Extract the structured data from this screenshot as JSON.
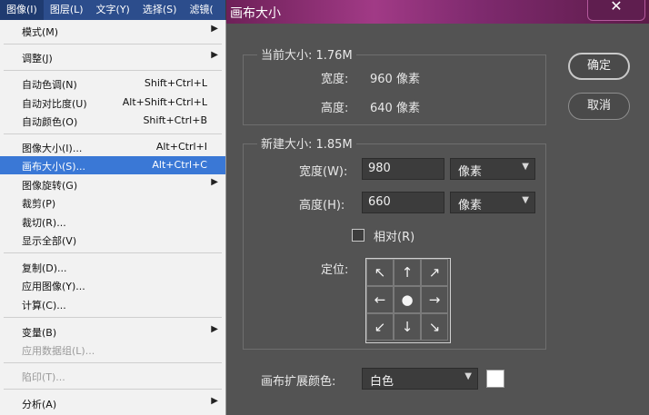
{
  "menubar": {
    "items": [
      "图像(I)",
      "图层(L)",
      "文字(Y)",
      "选择(S)",
      "滤镜("
    ]
  },
  "menu": {
    "items": [
      {
        "label": "模式(M)",
        "shortcut": "",
        "submenu": true
      },
      {
        "label": "调整(J)",
        "shortcut": "",
        "submenu": true
      },
      {
        "label": "自动色调(N)",
        "shortcut": "Shift+Ctrl+L"
      },
      {
        "label": "自动对比度(U)",
        "shortcut": "Alt+Shift+Ctrl+L"
      },
      {
        "label": "自动颜色(O)",
        "shortcut": "Shift+Ctrl+B"
      },
      {
        "label": "图像大小(I)...",
        "shortcut": "Alt+Ctrl+I"
      },
      {
        "label": "画布大小(S)...",
        "shortcut": "Alt+Ctrl+C",
        "highlighted": true
      },
      {
        "label": "图像旋转(G)",
        "shortcut": "",
        "submenu": true
      },
      {
        "label": "裁剪(P)",
        "shortcut": ""
      },
      {
        "label": "裁切(R)...",
        "shortcut": ""
      },
      {
        "label": "显示全部(V)",
        "shortcut": ""
      },
      {
        "label": "复制(D)...",
        "shortcut": ""
      },
      {
        "label": "应用图像(Y)...",
        "shortcut": ""
      },
      {
        "label": "计算(C)...",
        "shortcut": ""
      },
      {
        "label": "变量(B)",
        "shortcut": "",
        "submenu": true
      },
      {
        "label": "应用数据组(L)...",
        "shortcut": "",
        "disabled": true
      },
      {
        "label": "陷印(T)...",
        "shortcut": "",
        "disabled": true
      },
      {
        "label": "分析(A)",
        "shortcut": "",
        "submenu": true
      }
    ]
  },
  "dialog": {
    "title": "画布大小",
    "close": "✕",
    "current": {
      "legend": "当前大小: 1.76M",
      "width_label": "宽度:",
      "width_value": "960 像素",
      "height_label": "高度:",
      "height_value": "640 像素"
    },
    "new": {
      "legend": "新建大小: 1.85M",
      "width_label": "宽度(W):",
      "width_value": "980",
      "width_unit": "像素",
      "height_label": "高度(H):",
      "height_value": "660",
      "height_unit": "像素",
      "relative_label": "相对(R)",
      "relative_checked": false,
      "anchor_label": "定位:"
    },
    "extension": {
      "label": "画布扩展颜色:",
      "value": "白色",
      "swatch_color": "#ffffff"
    },
    "ok_label": "确定",
    "cancel_label": "取消"
  }
}
